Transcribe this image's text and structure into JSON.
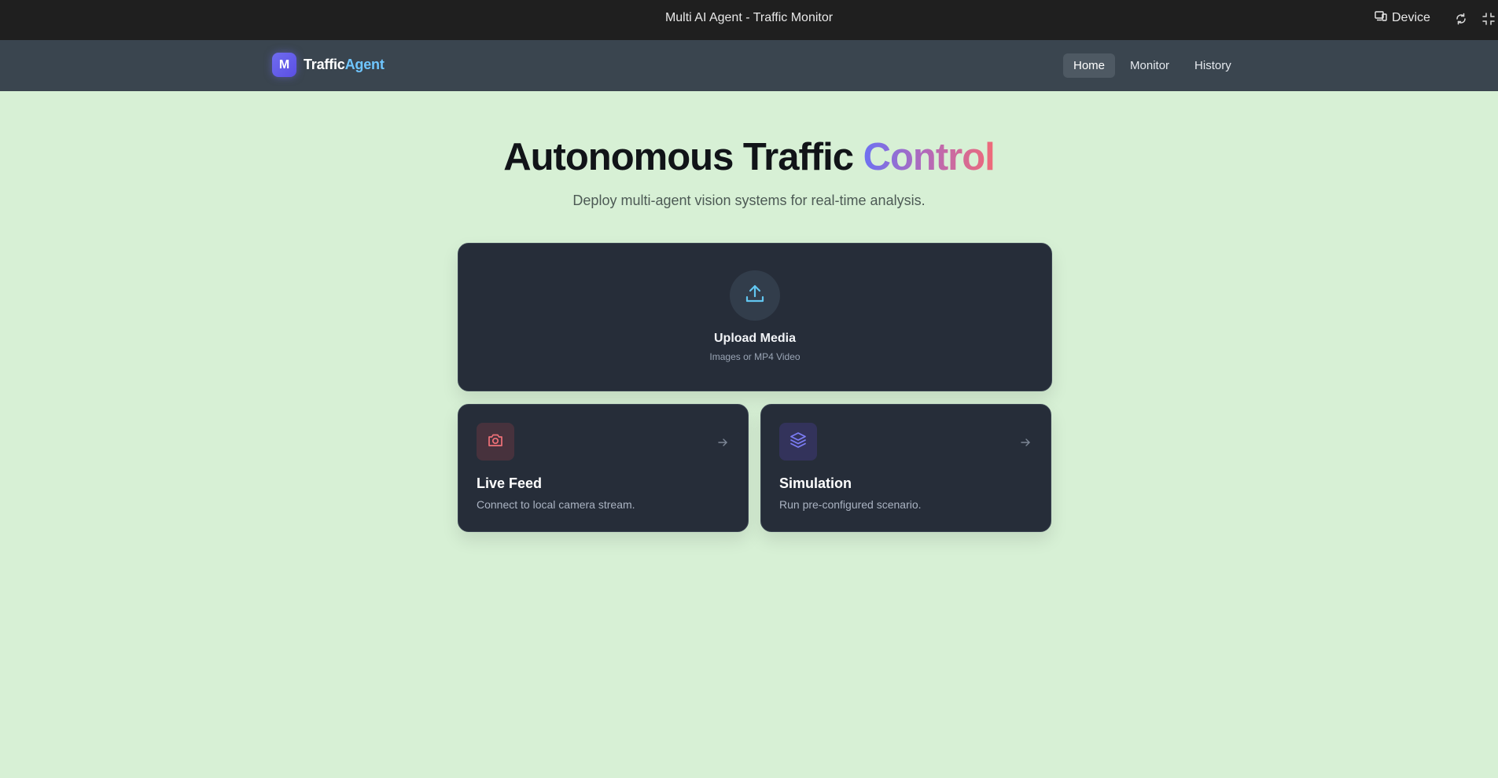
{
  "window": {
    "title": "Multi AI Agent - Traffic Monitor",
    "device_label": "Device"
  },
  "navbar": {
    "logo_letter": "M",
    "brand_primary": "Traffic",
    "brand_accent": "Agent",
    "links": [
      {
        "label": "Home",
        "active": true
      },
      {
        "label": "Monitor",
        "active": false
      },
      {
        "label": "History",
        "active": false
      }
    ]
  },
  "hero": {
    "title_plain": "Autonomous Traffic",
    "title_highlight": "Control",
    "subtitle": "Deploy multi-agent vision systems for real-time analysis."
  },
  "upload": {
    "icon": "upload-icon",
    "title": "Upload Media",
    "subtitle": "Images or MP4 Video"
  },
  "features": [
    {
      "icon": "camera-icon",
      "title": "Live Feed",
      "subtitle": "Connect to local camera stream.",
      "accent": "#f07178"
    },
    {
      "icon": "layers-icon",
      "title": "Simulation",
      "subtitle": "Run pre-configured scenario.",
      "accent": "#7b7cf5"
    }
  ],
  "colors": {
    "background": "#d7f0d5",
    "titlebar": "#1f1f1f",
    "navbar": "#3a454f",
    "card": "#262d39",
    "brand_accent": "#6fc6ff",
    "upload_icon": "#62c6f0"
  }
}
